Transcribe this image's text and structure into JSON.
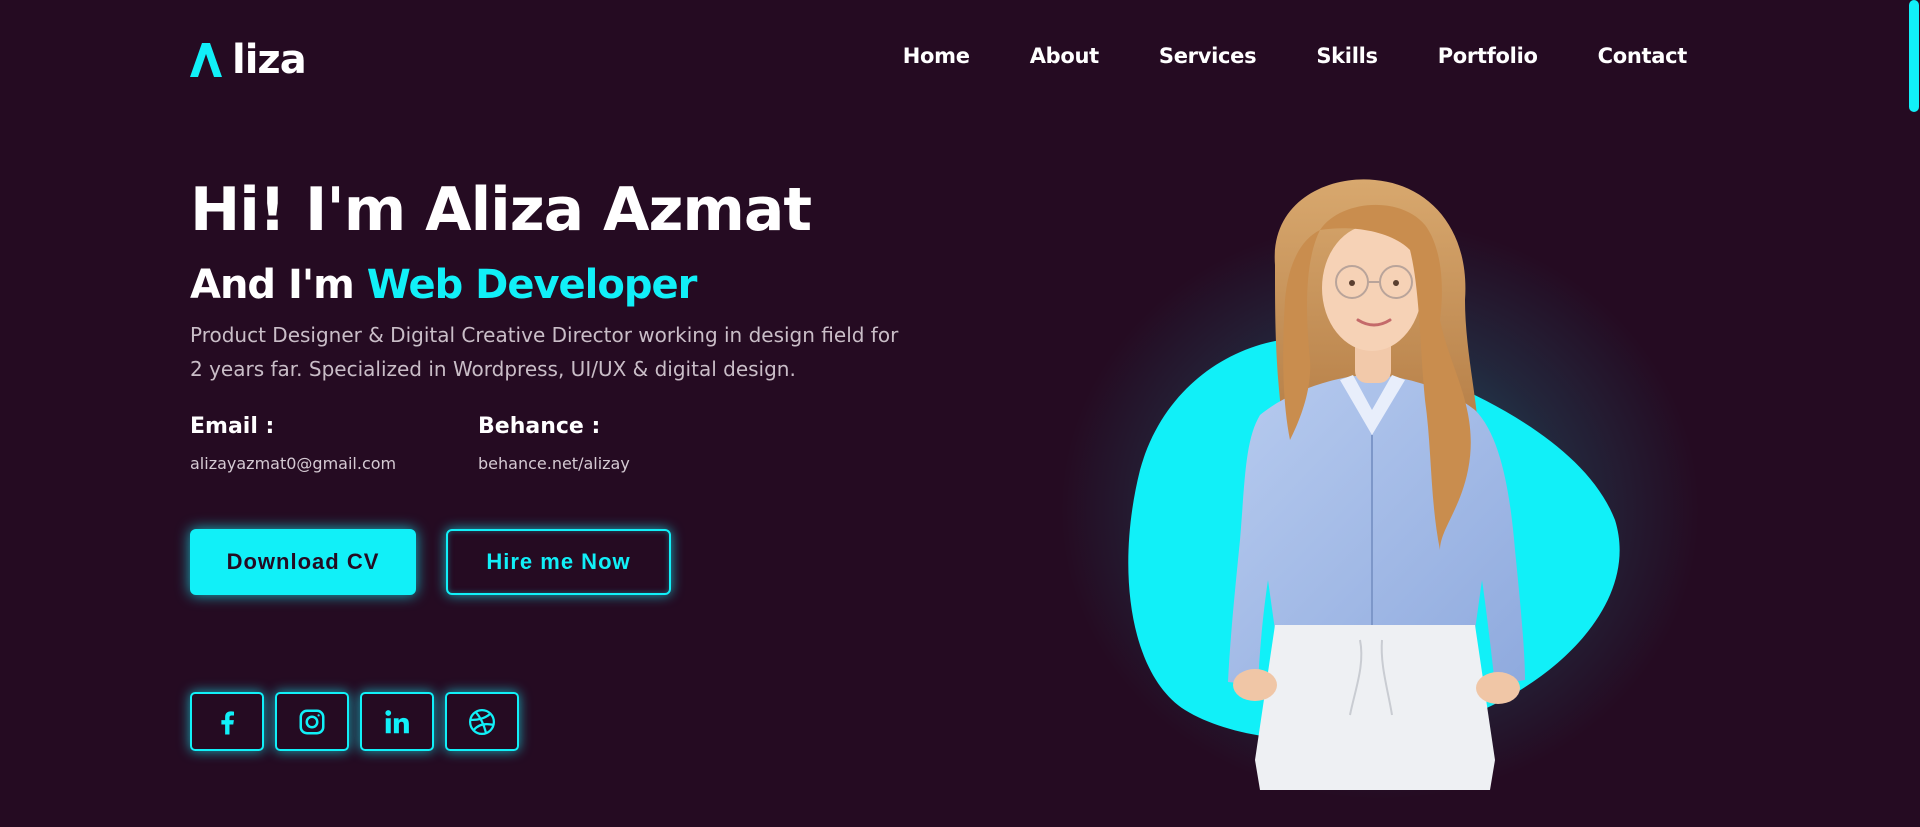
{
  "header": {
    "logo_text": "liza",
    "nav": [
      "Home",
      "About",
      "Services",
      "Skills",
      "Portfolio",
      "Contact"
    ]
  },
  "hero": {
    "title": "Hi! I'm Aliza Azmat",
    "subtitle_prefix": "And I'm",
    "subtitle_role": "Web Developer",
    "description": "Product Designer & Digital Creative Director working in design field for 2 years far. Specialized in Wordpress, UI/UX & digital design.",
    "email_label": "Email :",
    "email_value": "alizayazmat0@gmail.com",
    "behance_label": "Behance :",
    "behance_value": "behance.net/alizay",
    "download_label": "Download CV",
    "hire_label": "Hire me Now"
  },
  "socials": [
    {
      "name": "facebook-icon"
    },
    {
      "name": "instagram-icon"
    },
    {
      "name": "linkedin-icon"
    },
    {
      "name": "dribbble-icon"
    }
  ],
  "colors": {
    "background": "#250b22",
    "accent": "#11f0f8",
    "text": "#ffffff",
    "muted_text": "#c9bdc7"
  }
}
